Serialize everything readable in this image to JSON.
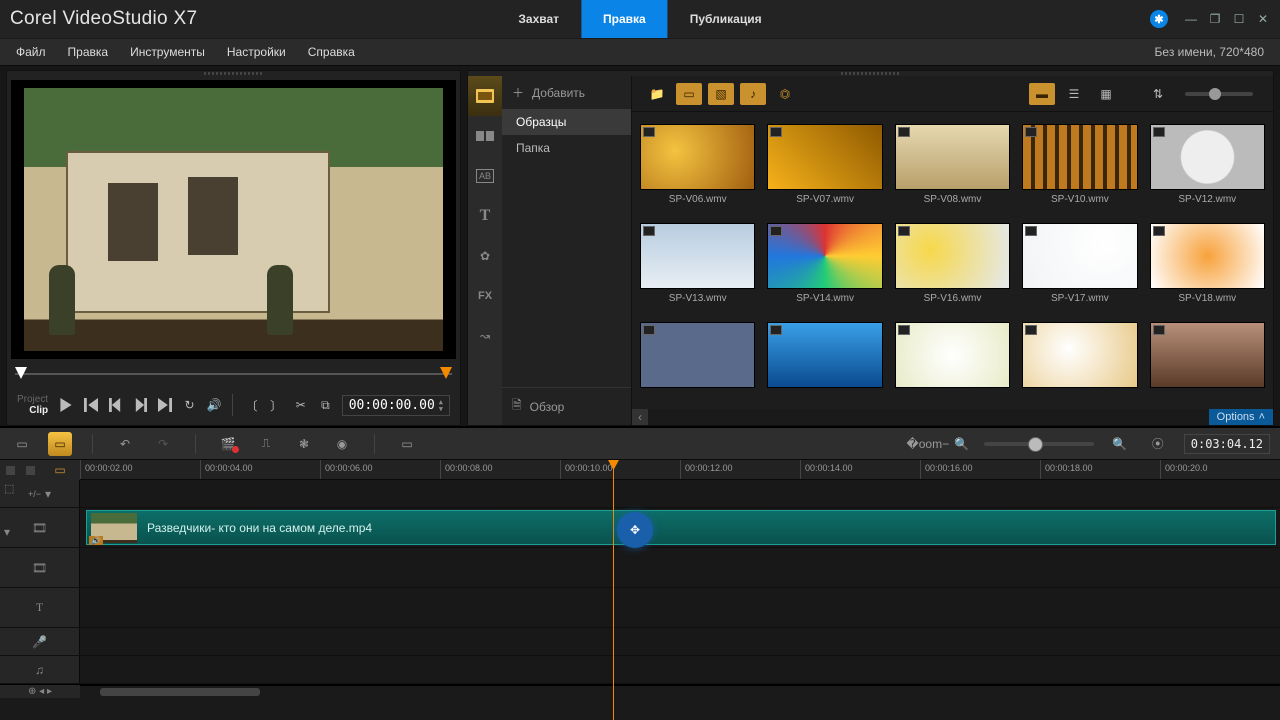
{
  "app": {
    "title": "Corel VideoStudio X7"
  },
  "steps": [
    {
      "label": "Захват",
      "active": false
    },
    {
      "label": "Правка",
      "active": true
    },
    {
      "label": "Публикация",
      "active": false
    }
  ],
  "menu": [
    "Файл",
    "Правка",
    "Инструменты",
    "Настройки",
    "Справка"
  ],
  "project_info": "Без имени, 720*480",
  "preview": {
    "mode_project": "Project",
    "mode_clip": "Clip",
    "timecode": "00:00:00.00"
  },
  "library": {
    "add_label": "Добавить",
    "review_label": "Обзор",
    "folders": [
      {
        "label": "Образцы",
        "active": true
      },
      {
        "label": "Папка",
        "active": false
      }
    ],
    "tabs": [
      {
        "name": "media",
        "active": true
      },
      {
        "name": "transitions"
      },
      {
        "name": "title-templates"
      },
      {
        "name": "titles"
      },
      {
        "name": "graphics"
      },
      {
        "name": "filters"
      },
      {
        "name": "paths"
      }
    ],
    "items": [
      {
        "label": "SP-V06.wmv",
        "cls": "t1"
      },
      {
        "label": "SP-V07.wmv",
        "cls": "t2"
      },
      {
        "label": "SP-V08.wmv",
        "cls": "t3"
      },
      {
        "label": "SP-V10.wmv",
        "cls": "t4"
      },
      {
        "label": "SP-V12.wmv",
        "cls": "t5"
      },
      {
        "label": "SP-V13.wmv",
        "cls": "t6"
      },
      {
        "label": "SP-V14.wmv",
        "cls": "t7"
      },
      {
        "label": "SP-V16.wmv",
        "cls": "t8"
      },
      {
        "label": "SP-V17.wmv",
        "cls": "t9"
      },
      {
        "label": "SP-V18.wmv",
        "cls": "t10"
      },
      {
        "label": "",
        "cls": "t11"
      },
      {
        "label": "",
        "cls": "t12"
      },
      {
        "label": "",
        "cls": "t13"
      },
      {
        "label": "",
        "cls": "t14"
      },
      {
        "label": "",
        "cls": "t15"
      }
    ],
    "options": "Options"
  },
  "timeline": {
    "duration": "0:03:04.12",
    "ruler": [
      "00:00:02.00",
      "00:00:04.00",
      "00:00:06.00",
      "00:00:08.00",
      "00:00:10.00",
      "00:00:12.00",
      "00:00:14.00",
      "00:00:16.00",
      "00:00:18.00",
      "00:00:20.0"
    ],
    "clip_name": "Разведчики- кто они на самом деле.mp4",
    "toggle_label": "+/−"
  }
}
